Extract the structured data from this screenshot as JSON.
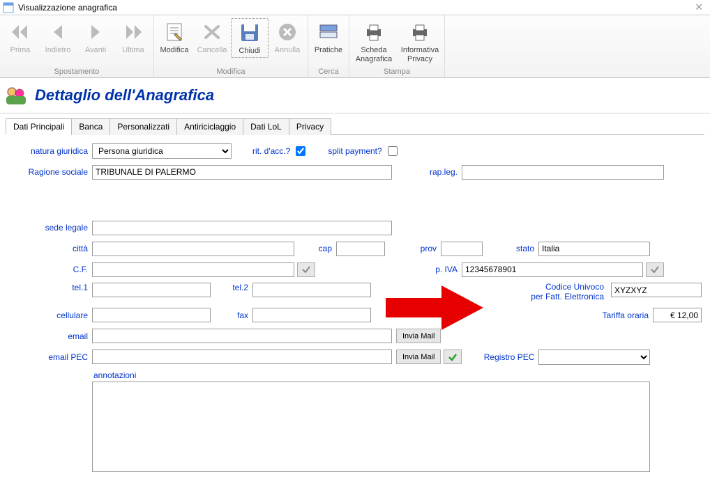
{
  "window": {
    "title": "Visualizzazione anagrafica"
  },
  "ribbon": {
    "groups": [
      {
        "label": "Spostamento",
        "buttons": [
          {
            "key": "prima",
            "label": "Prima",
            "disabled": true
          },
          {
            "key": "indietro",
            "label": "Indietro",
            "disabled": true
          },
          {
            "key": "avanti",
            "label": "Avanti",
            "disabled": true
          },
          {
            "key": "ultima",
            "label": "Ultima",
            "disabled": true
          }
        ]
      },
      {
        "label": "Modifica",
        "buttons": [
          {
            "key": "modifica",
            "label": "Modifica",
            "disabled": false
          },
          {
            "key": "cancella",
            "label": "Cancella",
            "disabled": true
          },
          {
            "key": "chiudi",
            "label": "Chiudi",
            "disabled": false,
            "selected": true
          },
          {
            "key": "annulla",
            "label": "Annulla",
            "disabled": true
          }
        ]
      },
      {
        "label": "Cerca",
        "buttons": [
          {
            "key": "pratiche",
            "label": "Pratiche",
            "disabled": false
          }
        ]
      },
      {
        "label": "Stampa",
        "buttons": [
          {
            "key": "scheda_anag",
            "label": "Scheda\nAnagrafica",
            "disabled": false
          },
          {
            "key": "info_priv",
            "label": "Informativa\nPrivacy",
            "disabled": false
          }
        ]
      }
    ]
  },
  "header": {
    "title": "Dettaglio dell'Anagrafica"
  },
  "tabs": [
    "Dati Principali",
    "Banca",
    "Personalizzati",
    "Antiriciclaggio",
    "Dati LoL",
    "Privacy"
  ],
  "labels": {
    "natura_giuridica": "natura giuridica",
    "rit_dacc": "rit. d'acc.?",
    "split_payment": "split payment?",
    "ragione_sociale": "Ragione sociale",
    "rap_leg": "rap.leg.",
    "sede_legale": "sede legale",
    "citta": "città",
    "cap": "cap",
    "prov": "prov",
    "stato": "stato",
    "cf": "C.F.",
    "piva": "p. IVA",
    "tel1": "tel.1",
    "tel2": "tel.2",
    "codice_univoco_1": "Codice Univoco",
    "codice_univoco_2": "per Fatt. Elettronica",
    "cellulare": "cellulare",
    "fax": "fax",
    "tariffa_oraria": "Tariffa oraria",
    "email": "email",
    "invia_mail": "Invia Mail",
    "email_pec": "email PEC",
    "registro_pec": "Registro PEC",
    "annotazioni": "annotazioni"
  },
  "values": {
    "natura_giuridica": "Persona giuridica",
    "rit_dacc": true,
    "split_payment": false,
    "ragione_sociale": "TRIBUNALE DI PALERMO",
    "rap_leg": "",
    "sede_legale": "",
    "citta": "",
    "cap": "",
    "prov": "",
    "stato": "Italia",
    "cf": "",
    "piva": "12345678901",
    "tel1": "",
    "tel2": "",
    "codice_univoco": "XYZXYZ",
    "cellulare": "",
    "fax": "",
    "tariffa_oraria": "€ 12,00",
    "email": "",
    "email_pec": "",
    "registro_pec": "",
    "annotazioni": ""
  }
}
